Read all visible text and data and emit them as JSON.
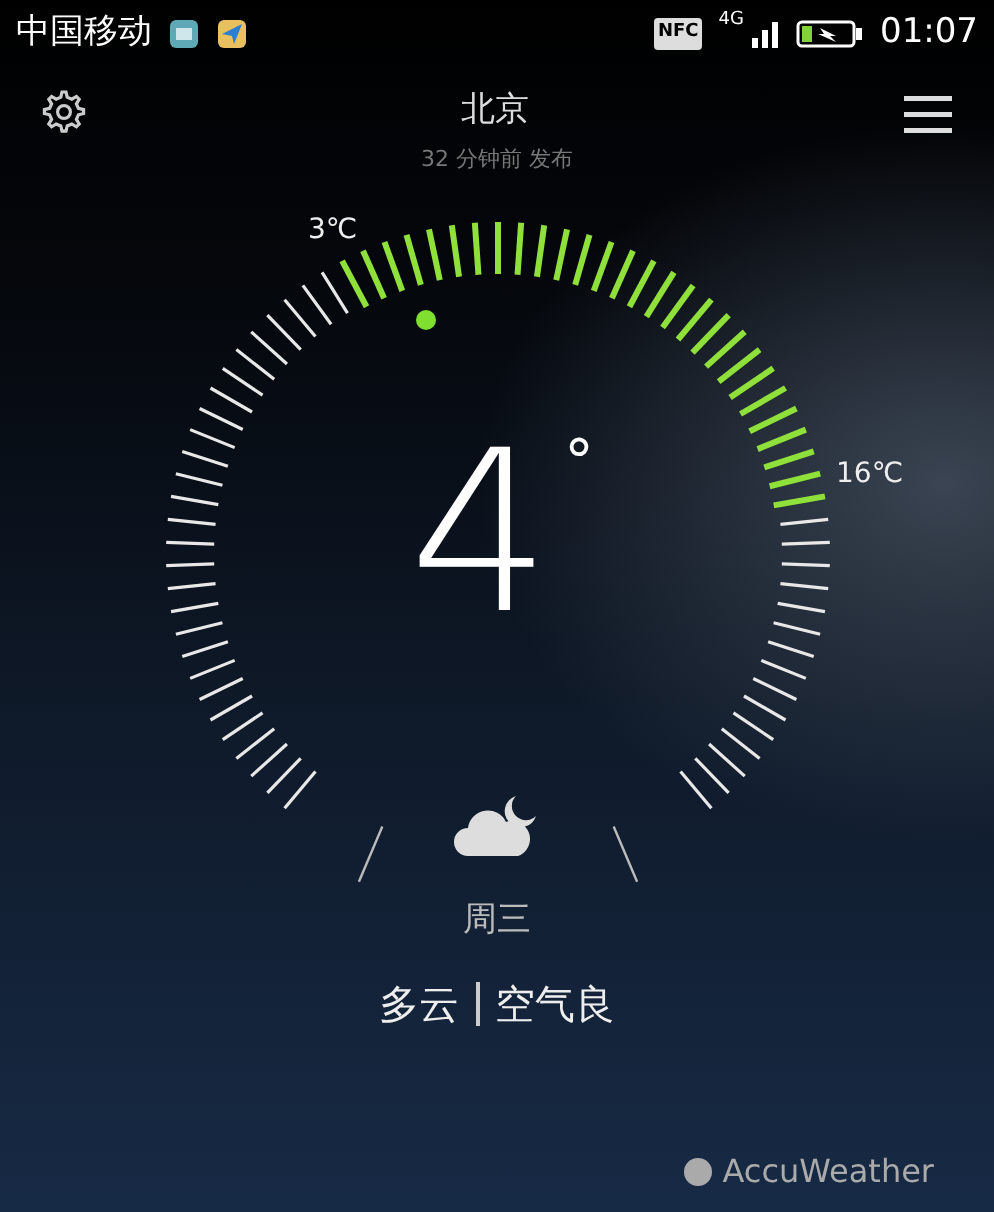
{
  "status_bar": {
    "carrier": "中国移动",
    "nfc": "NFC",
    "network": "4G",
    "time": "01:07"
  },
  "header": {
    "city": "北京",
    "updated": "32 分钟前 发布"
  },
  "gauge": {
    "low": "3℃",
    "high": "16℃",
    "temperature": "4",
    "degree": "°"
  },
  "day": "周三",
  "condition": "多云",
  "air_quality": "空气良",
  "footer": {
    "provider": "AccuWeather"
  }
}
